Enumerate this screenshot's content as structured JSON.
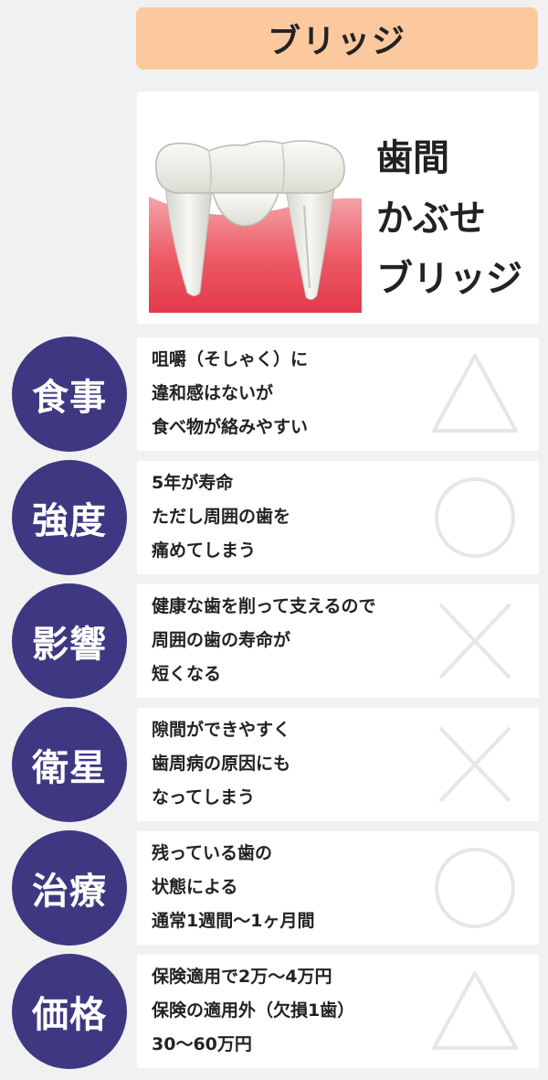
{
  "header": {
    "title": "ブリッジ"
  },
  "hero": {
    "lines": [
      "歯間",
      "かぶせ",
      "ブリッジ"
    ]
  },
  "rows": [
    {
      "label": "食事",
      "lines": [
        "咀嚼（そしゃく）に",
        "違和感はないが",
        "食べ物が絡みやすい"
      ],
      "mark": "triangle"
    },
    {
      "label": "強度",
      "lines": [
        "5年が寿命",
        "ただし周囲の歯を",
        "痛めてしまう"
      ],
      "mark": "circle"
    },
    {
      "label": "影響",
      "lines": [
        "健康な歯を削って支えるので",
        "周囲の歯の寿命が",
        "短くなる"
      ],
      "mark": "cross"
    },
    {
      "label": "衛星",
      "lines": [
        "隙間ができやすく",
        "歯周病の原因にも",
        "なってしまう"
      ],
      "mark": "cross"
    },
    {
      "label": "治療",
      "lines": [
        "残っている歯の",
        "状態による",
        "通常1週間〜1ヶ月間"
      ],
      "mark": "circle"
    },
    {
      "label": "価格",
      "lines": [
        "保険適用で2万〜4万円",
        "保険の適用外（欠損1歯）",
        "30〜60万円"
      ],
      "mark": "triangle"
    }
  ],
  "colors": {
    "header_bg": "#fcc99e",
    "label_circle": "#3e3882",
    "mark_stroke": "#e6e6e6",
    "gum": "#e9404f"
  }
}
